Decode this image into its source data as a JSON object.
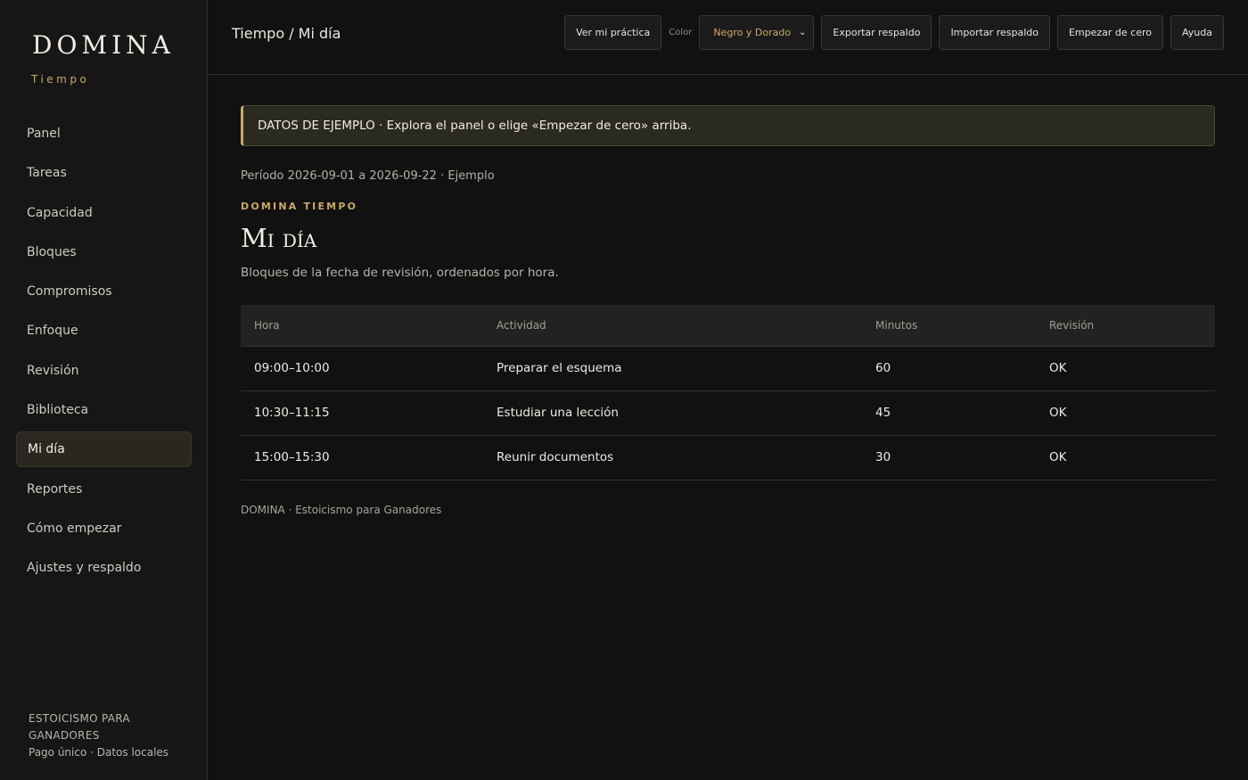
{
  "sidebar": {
    "brand": "DOMINA",
    "brand_sub": "Tiempo",
    "items": [
      {
        "label": "Panel"
      },
      {
        "label": "Tareas"
      },
      {
        "label": "Capacidad"
      },
      {
        "label": "Bloques"
      },
      {
        "label": "Compromisos"
      },
      {
        "label": "Enfoque"
      },
      {
        "label": "Revisión"
      },
      {
        "label": "Biblioteca"
      },
      {
        "label": "Mi día",
        "active": true
      },
      {
        "label": "Reportes"
      },
      {
        "label": "Cómo empezar"
      },
      {
        "label": "Ajustes y respaldo"
      }
    ],
    "footer_line1": "ESTOICISMO PARA",
    "footer_line2": "GANADORES",
    "footer_line3": "Pago único · Datos locales"
  },
  "topbar": {
    "breadcrumb": "Tiempo / Mi día",
    "practice_button": "Ver mi práctica",
    "color_label": "Color",
    "color_selected": "Negro y Dorado",
    "export_button": "Exportar respaldo",
    "import_button": "Importar respaldo",
    "reset_button": "Empezar de cero",
    "help_button": "Ayuda"
  },
  "main": {
    "banner": "DATOS DE EJEMPLO · Explora el panel o elige «Empezar de cero» arriba.",
    "period": "Período 2026-09-01 a 2026-09-22 · Ejemplo",
    "eyebrow": "DOMINA TIEMPO",
    "title": "Mi día",
    "description": "Bloques de la fecha de revisión, ordenados por hora.",
    "table": {
      "headers": [
        "Hora",
        "Actividad",
        "Minutos",
        "Revisión"
      ],
      "rows": [
        [
          "09:00–10:00",
          "Preparar el esquema",
          "60",
          "OK"
        ],
        [
          "10:30–11:15",
          "Estudiar una lección",
          "45",
          "OK"
        ],
        [
          "15:00–15:30",
          "Reunir documentos",
          "30",
          "OK"
        ]
      ]
    },
    "footer": "DOMINA · Estoicismo para Ganadores"
  },
  "colors": {
    "background": "#111111",
    "sidebar": "#161616",
    "accent_gold": "#c9a86a",
    "banner_bg": "#2b2a21"
  }
}
